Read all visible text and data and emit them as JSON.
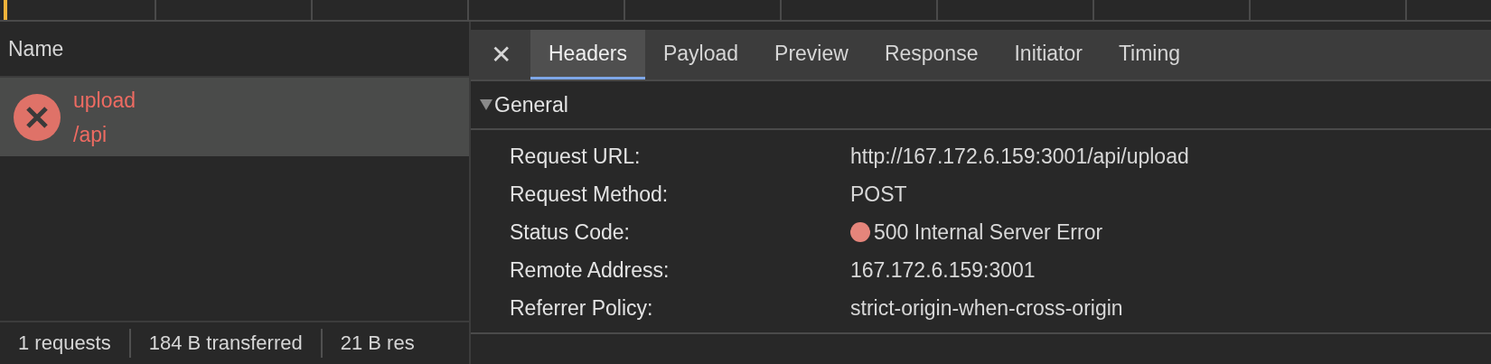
{
  "name_column": {
    "heading": "Name"
  },
  "requests": [
    {
      "name": "upload",
      "path": "/api",
      "failed": true,
      "selected": true
    }
  ],
  "summary": [
    "1 requests",
    "184 B transferred",
    "21 B res"
  ],
  "close_icon": "✕",
  "tabs": [
    {
      "label": "Headers",
      "selected": true
    },
    {
      "label": "Payload",
      "selected": false
    },
    {
      "label": "Preview",
      "selected": false
    },
    {
      "label": "Response",
      "selected": false
    },
    {
      "label": "Initiator",
      "selected": false
    },
    {
      "label": "Timing",
      "selected": false
    }
  ],
  "general": {
    "title": "General",
    "expanded": true,
    "rows": [
      {
        "label": "Request URL:",
        "value": "http://167.172.6.159:3001/api/upload"
      },
      {
        "label": "Request Method:",
        "value": "POST"
      },
      {
        "label": "Status Code:",
        "value": "500 Internal Server Error",
        "color": "#e5857b"
      },
      {
        "label": "Remote Address:",
        "value": "167.172.6.159:3001"
      },
      {
        "label": "Referrer Policy:",
        "value": "strict-origin-when-cross-origin"
      }
    ]
  }
}
